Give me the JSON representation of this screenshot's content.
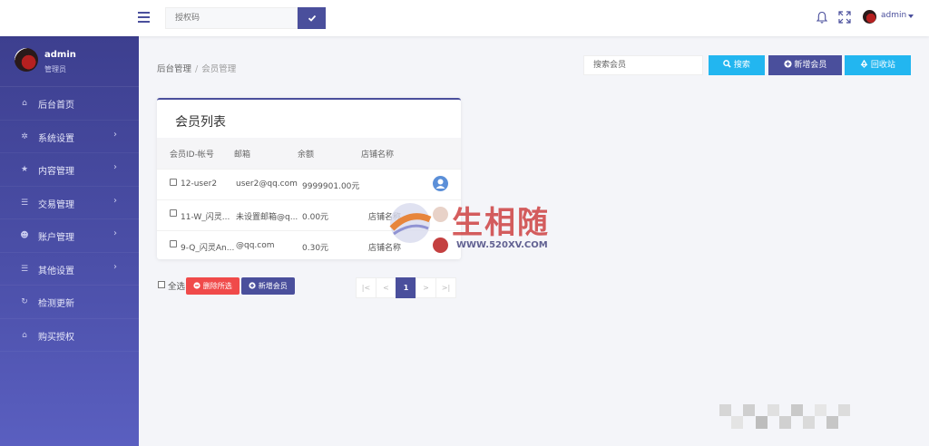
{
  "topbar": {
    "auth_placeholder": "授权码",
    "auth_btn_icon": "check-icon",
    "user": "admin"
  },
  "sidebar": {
    "name": "admin",
    "role": "管理员",
    "items": [
      {
        "label": "后台首页",
        "icon": "home-icon",
        "arrow": false
      },
      {
        "label": "系统设置",
        "icon": "gear-icon",
        "arrow": true
      },
      {
        "label": "内容管理",
        "icon": "star-icon",
        "arrow": true
      },
      {
        "label": "交易管理",
        "icon": "list-icon",
        "arrow": true
      },
      {
        "label": "账户管理",
        "icon": "users-icon",
        "arrow": true
      },
      {
        "label": "其他设置",
        "icon": "list-icon",
        "arrow": true
      },
      {
        "label": "检测更新",
        "icon": "refresh-icon",
        "arrow": false
      },
      {
        "label": "购买授权",
        "icon": "home-icon",
        "arrow": false
      }
    ],
    "arrow_glyph": "›"
  },
  "breadcrumb": {
    "root": "后台管理",
    "sep": "/",
    "current": "会员管理"
  },
  "toolbar": {
    "search_placeholder": "搜索会员",
    "search_btn": "搜索",
    "add_btn": "新增会员",
    "recycle_btn": "回收站"
  },
  "panel": {
    "title": "会员列表",
    "headers": [
      "会员ID-帐号",
      "邮箱",
      "余额",
      "店铺名称"
    ],
    "rows": [
      {
        "id": "12-user2",
        "email": "user2@qq.com",
        "balance": "9999901.00元",
        "shop": ""
      },
      {
        "id": "11-W_闪灵...",
        "email": "未设置邮箱@q...",
        "balance": "0.00元",
        "shop": "店铺名称"
      },
      {
        "id": "9-Q_闪灵An...",
        "email": "@qq.com",
        "balance": "0.30元",
        "shop": "店铺名称"
      }
    ]
  },
  "footer": {
    "select_all": "全选",
    "delete_btn": "删除所选",
    "add_btn": "新增会员"
  },
  "pager": [
    "|<",
    "<",
    "1",
    ">",
    ">|"
  ],
  "pager_active": "1",
  "watermark": {
    "text": "生相随",
    "url": "WWW.520XV.COM"
  },
  "colors": {
    "accent": "#4a4f9c",
    "info": "#22b6f0",
    "danger": "#f04a4a"
  }
}
